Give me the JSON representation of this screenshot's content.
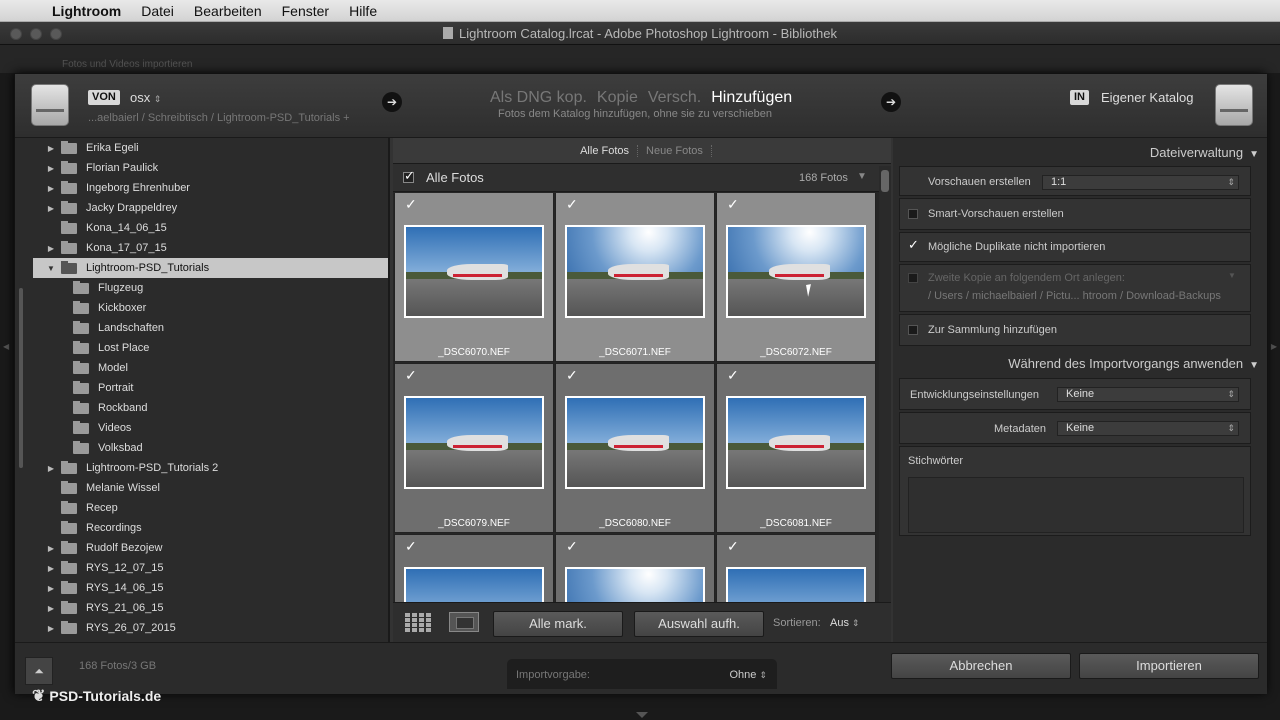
{
  "menubar": {
    "items": [
      "Lightroom",
      "Datei",
      "Bearbeiten",
      "Fenster",
      "Hilfe"
    ]
  },
  "window": {
    "title": "Lightroom Catalog.lrcat - Adobe Photoshop Lightroom - Bibliothek"
  },
  "background": {
    "text": "Fotos und Videos importieren"
  },
  "source": {
    "badge": "VON",
    "name": "osx",
    "path": "...aelbaierl / Schreibtisch / Lightroom-PSD_Tutorials +"
  },
  "modes": {
    "items": [
      "Als DNG kop.",
      "Kopie",
      "Versch.",
      "Hinzufügen"
    ],
    "active": "Hinzufügen",
    "description": "Fotos dem Katalog hinzufügen, ohne sie zu verschieben"
  },
  "destination": {
    "badge": "IN",
    "name": "Eigener Katalog"
  },
  "folders": [
    {
      "label": "Erika Egeli",
      "level": 0,
      "expandable": true
    },
    {
      "label": "Florian Paulick",
      "level": 0,
      "expandable": true
    },
    {
      "label": "Ingeborg Ehrenhuber",
      "level": 0,
      "expandable": true
    },
    {
      "label": "Jacky Drappeldrey",
      "level": 0,
      "expandable": true
    },
    {
      "label": "Kona_14_06_15",
      "level": 0,
      "expandable": false
    },
    {
      "label": "Kona_17_07_15",
      "level": 0,
      "expandable": true
    },
    {
      "label": "Lightroom-PSD_Tutorials",
      "level": 0,
      "expandable": true,
      "expanded": true,
      "selected": true
    },
    {
      "label": "Flugzeug",
      "level": 1,
      "expandable": false
    },
    {
      "label": "Kickboxer",
      "level": 1,
      "expandable": false
    },
    {
      "label": "Landschaften",
      "level": 1,
      "expandable": false
    },
    {
      "label": "Lost Place",
      "level": 1,
      "expandable": false
    },
    {
      "label": "Model",
      "level": 1,
      "expandable": false
    },
    {
      "label": "Portrait",
      "level": 1,
      "expandable": false
    },
    {
      "label": "Rockband",
      "level": 1,
      "expandable": false
    },
    {
      "label": "Videos",
      "level": 1,
      "expandable": false
    },
    {
      "label": "Volksbad",
      "level": 1,
      "expandable": false
    },
    {
      "label": "Lightroom-PSD_Tutorials 2",
      "level": 0,
      "expandable": true
    },
    {
      "label": "Melanie Wissel",
      "level": 0,
      "expandable": false
    },
    {
      "label": "Recep",
      "level": 0,
      "expandable": false
    },
    {
      "label": "Recordings",
      "level": 0,
      "expandable": false
    },
    {
      "label": "Rudolf Bezojew",
      "level": 0,
      "expandable": true
    },
    {
      "label": "RYS_12_07_15",
      "level": 0,
      "expandable": true
    },
    {
      "label": "RYS_14_06_15",
      "level": 0,
      "expandable": true
    },
    {
      "label": "RYS_21_06_15",
      "level": 0,
      "expandable": true
    },
    {
      "label": "RYS_26_07_2015",
      "level": 0,
      "expandable": true
    }
  ],
  "filter": {
    "tabs": [
      "Alle Fotos",
      "Neue Fotos"
    ],
    "active": "Alle Fotos"
  },
  "gridhead": {
    "label": "Alle Fotos",
    "count": "168 Fotos"
  },
  "photos": [
    {
      "name": "_DSC6070.NEF",
      "checked": true,
      "bright": false
    },
    {
      "name": "_DSC6071.NEF",
      "checked": true,
      "bright": true
    },
    {
      "name": "_DSC6072.NEF",
      "checked": true,
      "bright": true
    },
    {
      "name": "_DSC6079.NEF",
      "checked": true,
      "bright": false
    },
    {
      "name": "_DSC6080.NEF",
      "checked": true,
      "bright": false
    },
    {
      "name": "_DSC6081.NEF",
      "checked": true,
      "bright": false
    },
    {
      "name": "",
      "checked": true,
      "bright": false
    },
    {
      "name": "",
      "checked": true,
      "bright": true
    },
    {
      "name": "",
      "checked": true,
      "bright": false
    }
  ],
  "gridbar": {
    "check_all": "Alle mark.",
    "uncheck_all": "Auswahl aufh.",
    "sort_label": "Sortieren:",
    "sort_value": "Aus"
  },
  "filemgmt": {
    "title": "Dateiverwaltung",
    "previews_label": "Vorschauen erstellen",
    "previews_value": "1:1",
    "smart_previews": "Smart-Vorschauen erstellen",
    "no_duplicates": "Mögliche Duplikate nicht importieren",
    "second_copy": "Zweite Kopie an folgendem Ort anlegen:",
    "second_copy_path": "/ Users / michaelbaierl / Pictu... htroom / Download-Backups",
    "add_collection": "Zur Sammlung hinzufügen"
  },
  "apply": {
    "title": "Während des Importvorgangs anwenden",
    "develop_label": "Entwicklungseinstellungen",
    "develop_value": "Keine",
    "metadata_label": "Metadaten",
    "metadata_value": "Keine",
    "keywords_label": "Stichwörter"
  },
  "footer": {
    "count": "168 Fotos/3 GB",
    "preset_label": "Importvorgabe:",
    "preset_value": "Ohne",
    "cancel": "Abbrechen",
    "import": "Importieren"
  },
  "logo": {
    "text": "PSD-Tutorials.de"
  }
}
